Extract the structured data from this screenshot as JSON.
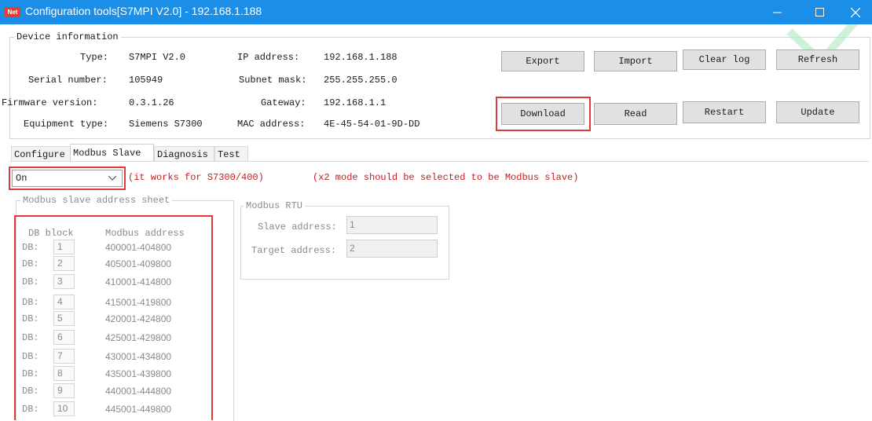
{
  "window": {
    "app_icon_text": "Net",
    "title": "Configuration tools[S7MPI V2.0] - 192.168.1.188",
    "colors": {
      "titlebar": "#1b8ee8",
      "highlight": "#e03b3b",
      "note_text": "#c21f1f"
    }
  },
  "device_info": {
    "group_label": "Device information",
    "type_label": "Type:",
    "type_value": "S7MPI V2.0",
    "serial_label": "Serial number:",
    "serial_value": "105949",
    "firmware_label": "Firmware version:",
    "firmware_value": "0.3.1.26",
    "equipment_label": "Equipment type:",
    "equipment_value": "Siemens S7300",
    "ip_label": "IP  address:",
    "ip_value": "192.168.1.188",
    "subnet_label": "Subnet mask:",
    "subnet_value": "255.255.255.0",
    "gateway_label": "Gateway:",
    "gateway_value": "192.168.1.1",
    "mac_label": "MAC address:",
    "mac_value": "4E-45-54-01-9D-DD"
  },
  "buttons": {
    "export": "Export",
    "import": "Import",
    "clear_log": "Clear log",
    "refresh": "Refresh",
    "download": "Download",
    "read": "Read",
    "restart": "Restart",
    "update": "Update"
  },
  "tabs": [
    "Configure",
    "Modbus Slave",
    "Diagnosis",
    "Test"
  ],
  "modbus": {
    "mode_value": "On",
    "note1": "(it works for S7300/400)",
    "note2": "(x2 mode should be selected to be Modbus slave)",
    "sheet_group_label": "Modbus slave  address sheet",
    "col_db": "DB block",
    "col_addr": "Modbus address",
    "row_prefix": "DB:",
    "rows": [
      {
        "db": "1",
        "addr": "400001-404800"
      },
      {
        "db": "2",
        "addr": "405001-409800"
      },
      {
        "db": "3",
        "addr": "410001-414800"
      },
      {
        "db": "4",
        "addr": "415001-419800"
      },
      {
        "db": "5",
        "addr": "420001-424800"
      },
      {
        "db": "6",
        "addr": "425001-429800"
      },
      {
        "db": "7",
        "addr": "430001-434800"
      },
      {
        "db": "8",
        "addr": "435001-439800"
      },
      {
        "db": "9",
        "addr": "440001-444800"
      },
      {
        "db": "10",
        "addr": "445001-449800"
      }
    ],
    "rtu_group_label": "Modbus RTU",
    "slave_addr_label": "Slave address:",
    "slave_addr_value": "1",
    "target_addr_label": "Target address:",
    "target_addr_value": "2"
  }
}
